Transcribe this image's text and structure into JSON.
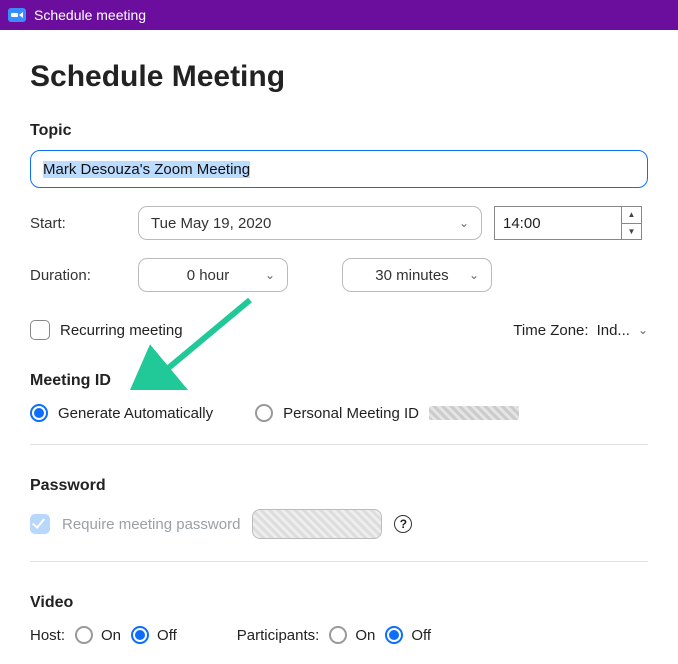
{
  "titlebar": {
    "text": "Schedule meeting"
  },
  "page": {
    "heading": "Schedule Meeting"
  },
  "topic": {
    "label": "Topic",
    "value": "Mark Desouza's Zoom Meeting"
  },
  "start": {
    "label": "Start:",
    "date": "Tue  May 19, 2020",
    "time": "14:00"
  },
  "duration": {
    "label": "Duration:",
    "hours": "0 hour",
    "minutes": "30 minutes"
  },
  "recurring": {
    "label": "Recurring meeting",
    "checked": false
  },
  "timezone": {
    "label": "Time Zone:",
    "value": "Ind..."
  },
  "meetingId": {
    "heading": "Meeting ID",
    "generate": {
      "label": "Generate Automatically",
      "selected": true
    },
    "personal": {
      "label": "Personal Meeting ID",
      "selected": false
    }
  },
  "password": {
    "heading": "Password",
    "require_label": "Require meeting password",
    "checked": true
  },
  "video": {
    "heading": "Video",
    "host_label": "Host:",
    "participants_label": "Participants:",
    "on_label": "On",
    "off_label": "Off",
    "host_value": "Off",
    "participants_value": "Off"
  }
}
